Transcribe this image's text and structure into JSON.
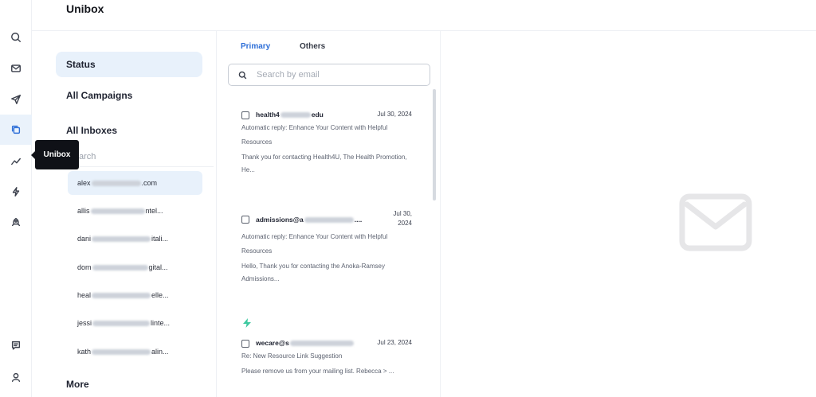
{
  "app": {
    "title": "Unibox"
  },
  "rail": {
    "icons": [
      "search-icon",
      "mail-icon",
      "send-icon",
      "unibox-icon",
      "analytics-icon",
      "bolt-icon",
      "rocket-icon",
      "feedback-icon",
      "user-icon"
    ],
    "active": "unibox-icon",
    "tooltip": "Unibox"
  },
  "sidebar": {
    "status_label": "Status",
    "all_campaigns_label": "All Campaigns",
    "all_inboxes_label": "All Inboxes",
    "search_stub": "arch",
    "more_label": "More",
    "inboxes": [
      {
        "prefix": "alex",
        "suffix": ".com"
      },
      {
        "prefix": "allis",
        "suffix": "ntel..."
      },
      {
        "prefix": "dani",
        "suffix": "itali..."
      },
      {
        "prefix": "dom",
        "suffix": "gital..."
      },
      {
        "prefix": "heal",
        "suffix": "elle..."
      },
      {
        "prefix": "jessi",
        "suffix": "linte..."
      },
      {
        "prefix": "kath",
        "suffix": "alin..."
      }
    ]
  },
  "list": {
    "tabs": [
      "Primary",
      "Others"
    ],
    "search_placeholder": "Search by email",
    "messages": [
      {
        "sender_prefix": "health4",
        "sender_suffix": "edu",
        "date": "Jul 30, 2024",
        "subject": "Automatic reply: Enhance Your Content with Helpful Resources",
        "preview": "Thank you for contacting Health4U, The Health Promotion, He..."
      },
      {
        "sender_prefix": "admissions@a",
        "sender_suffix": "....",
        "date": "Jul 30, 2024",
        "subject": "Automatic reply: Enhance Your Content with Helpful Resources",
        "preview": "Hello, Thank you for contacting the Anoka-Ramsey Admissions..."
      },
      {
        "sender_prefix": "wecare@s",
        "sender_suffix": "",
        "date": "Jul 23, 2024",
        "subject": "Re: New Resource Link Suggestion",
        "preview": "Please remove us from your mailing list. Rebecca > ..."
      }
    ]
  },
  "colors": {
    "accent": "#2e6fd8",
    "selected_bg": "#e8f1fb",
    "bolt": "#3ec9a0"
  }
}
